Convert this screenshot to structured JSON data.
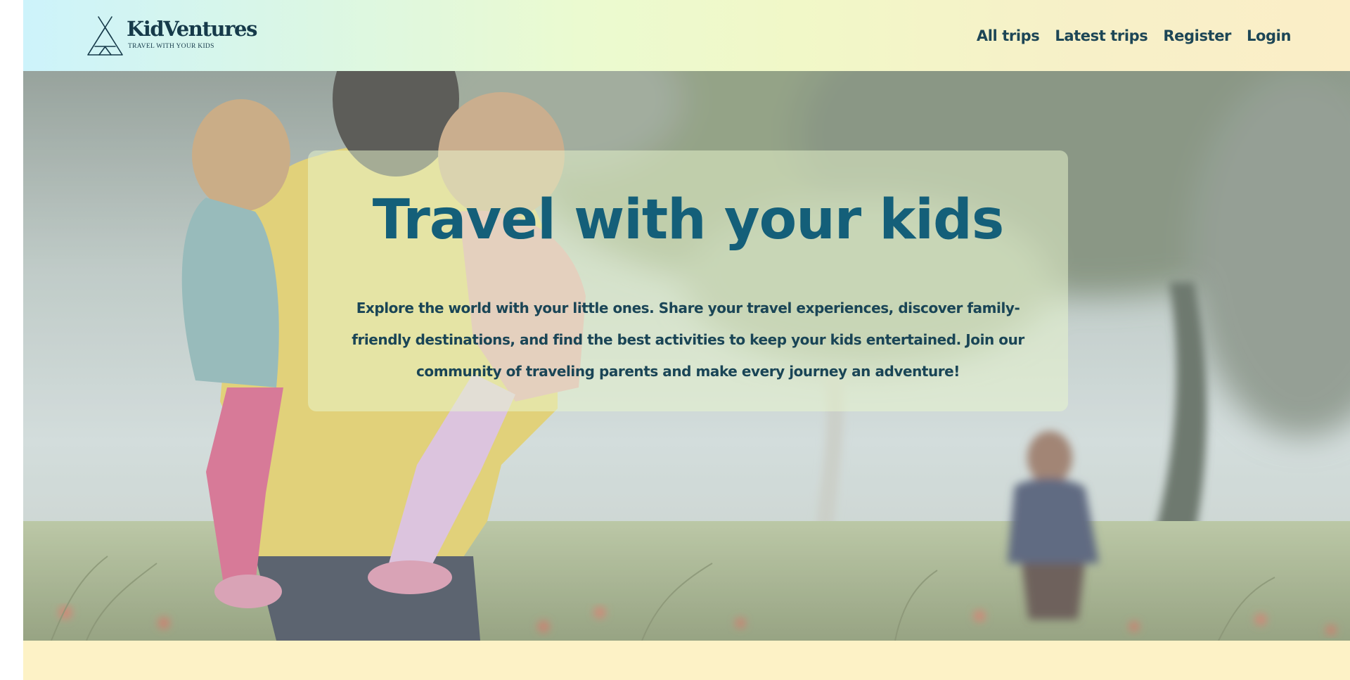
{
  "brand": {
    "name": "KidVentures",
    "tagline": "TRAVEL WITH YOUR KIDS",
    "icon": "teepee-icon"
  },
  "nav": {
    "items": [
      {
        "label": "All trips"
      },
      {
        "label": "Latest trips"
      },
      {
        "label": "Register"
      },
      {
        "label": "Login"
      }
    ]
  },
  "hero": {
    "title": "Travel with your kids",
    "description": "Explore the world with your little ones. Share your travel experiences, discover family-friendly destinations, and find the best activities to keep your kids entertained. Join our community of traveling parents and make every journey an adventure!"
  },
  "colors": {
    "header_gradient_start": "#cdf3fb",
    "header_gradient_end": "#fbeec7",
    "nav_text": "#1d4656",
    "hero_title": "#145f79",
    "hero_text": "#1a4556",
    "footer_band": "#fdf2c6"
  }
}
